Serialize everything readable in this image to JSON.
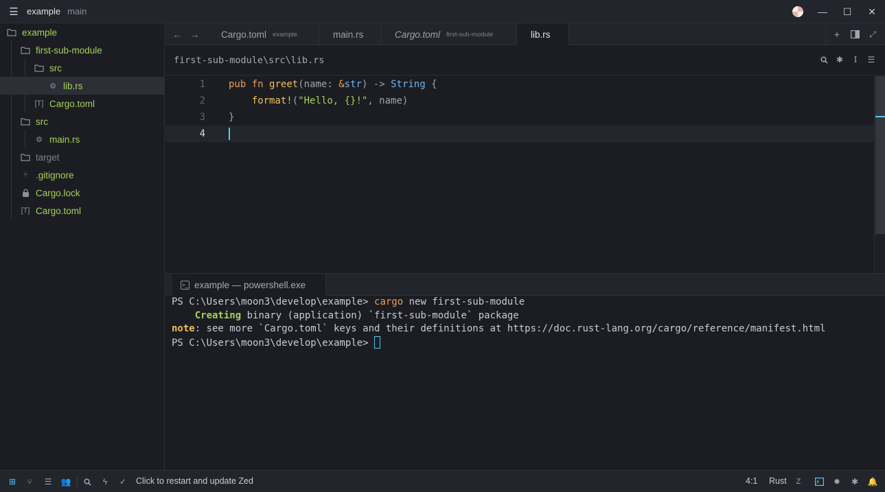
{
  "titlebar": {
    "project": "example",
    "branch": "main",
    "menu_icon": "hamburger-icon",
    "minimize_glyph": "—",
    "maximize_glyph": "☐",
    "close_glyph": "✕"
  },
  "sidebar": {
    "items": [
      {
        "label": "example",
        "icon": "folder-open-icon"
      },
      {
        "label": "first-sub-module",
        "icon": "folder-open-icon"
      },
      {
        "label": "src",
        "icon": "folder-open-icon"
      },
      {
        "label": "lib.rs",
        "icon": "rust-file-icon"
      },
      {
        "label": "Cargo.toml",
        "icon": "toml-file-icon"
      },
      {
        "label": "src",
        "icon": "folder-open-icon"
      },
      {
        "label": "main.rs",
        "icon": "rust-file-icon"
      },
      {
        "label": "target",
        "icon": "folder-icon"
      },
      {
        "label": ".gitignore",
        "icon": "git-icon"
      },
      {
        "label": "Cargo.lock",
        "icon": "lock-icon"
      },
      {
        "label": "Cargo.toml",
        "icon": "toml-file-icon"
      }
    ]
  },
  "tabs": [
    {
      "label": "Cargo.toml",
      "sub": "example"
    },
    {
      "label": "main.rs",
      "sub": ""
    },
    {
      "label": "Cargo.toml",
      "sub": "first-sub-module"
    },
    {
      "label": "lib.rs",
      "sub": ""
    }
  ],
  "breadcrumb": "first-sub-module\\src\\lib.rs",
  "editor": {
    "line_numbers": [
      "1",
      "2",
      "3",
      "4"
    ],
    "line1": {
      "kw1": "pub",
      "kw2": "fn",
      "fname": "greet",
      "p1": "(name: ",
      "amp": "&",
      "ty": "str",
      "p2": ") -> ",
      "ret": "String",
      "p3": " {"
    },
    "line2": {
      "indent": "    ",
      "macro": "format!",
      "p1": "(",
      "str": "\"Hello, {}!\"",
      "p2": ", name)"
    },
    "line3": {
      "text": "}"
    }
  },
  "terminal": {
    "tab_label": "example — powershell.exe",
    "prompt": "PS C:\\Users\\moon3\\develop\\example> ",
    "command": "cargo",
    "args": " new first-sub-module",
    "creating_label": "    Creating",
    "creating_rest": " binary (application) `first-sub-module` package",
    "note_label": "note",
    "note_rest": ": see more `Cargo.toml` keys and their definitions at https://doc.rust-lang.org/cargo/reference/manifest.html",
    "prompt2": "PS C:\\Users\\moon3\\develop\\example> "
  },
  "statusbar": {
    "update_text": "Click to restart and update Zed",
    "position": "4:1",
    "language": "Rust"
  }
}
